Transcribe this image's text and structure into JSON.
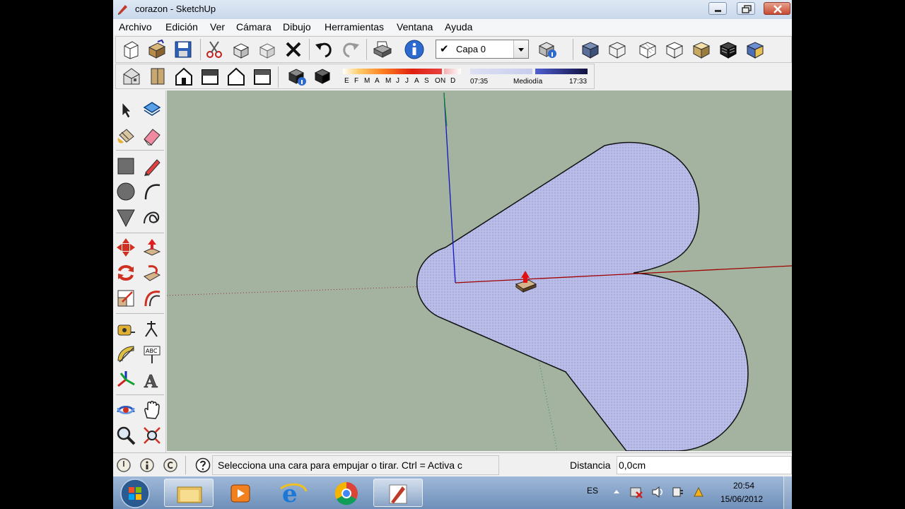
{
  "window": {
    "title": "corazon - SketchUp"
  },
  "menu": {
    "items": [
      "Archivo",
      "Edición",
      "Ver",
      "Cámara",
      "Dibujo",
      "Herramientas",
      "Ventana",
      "Ayuda"
    ]
  },
  "toolbar": {
    "layer_select_value": "Capa 0"
  },
  "shadows": {
    "months": [
      "E",
      "F",
      "M",
      "A",
      "M",
      "J",
      "J",
      "A",
      "S",
      "O",
      "N",
      "D"
    ],
    "time_start": "07:35",
    "time_mid": "Mediodía",
    "time_end": "17:33"
  },
  "status": {
    "message": "Selecciona una cara para empujar o tirar. Ctrl = Activa c",
    "measure_label": "Distancia",
    "measure_value": "0,0cm"
  },
  "taskbar": {
    "language": "ES",
    "time": "20:54",
    "date": "15/06/2012"
  },
  "colors": {
    "viewport_bg": "#a4b3a0",
    "face_fill": "#b9bde8",
    "axis_red": "#b00000",
    "axis_green": "#00a000",
    "axis_blue": "#0000c0"
  }
}
